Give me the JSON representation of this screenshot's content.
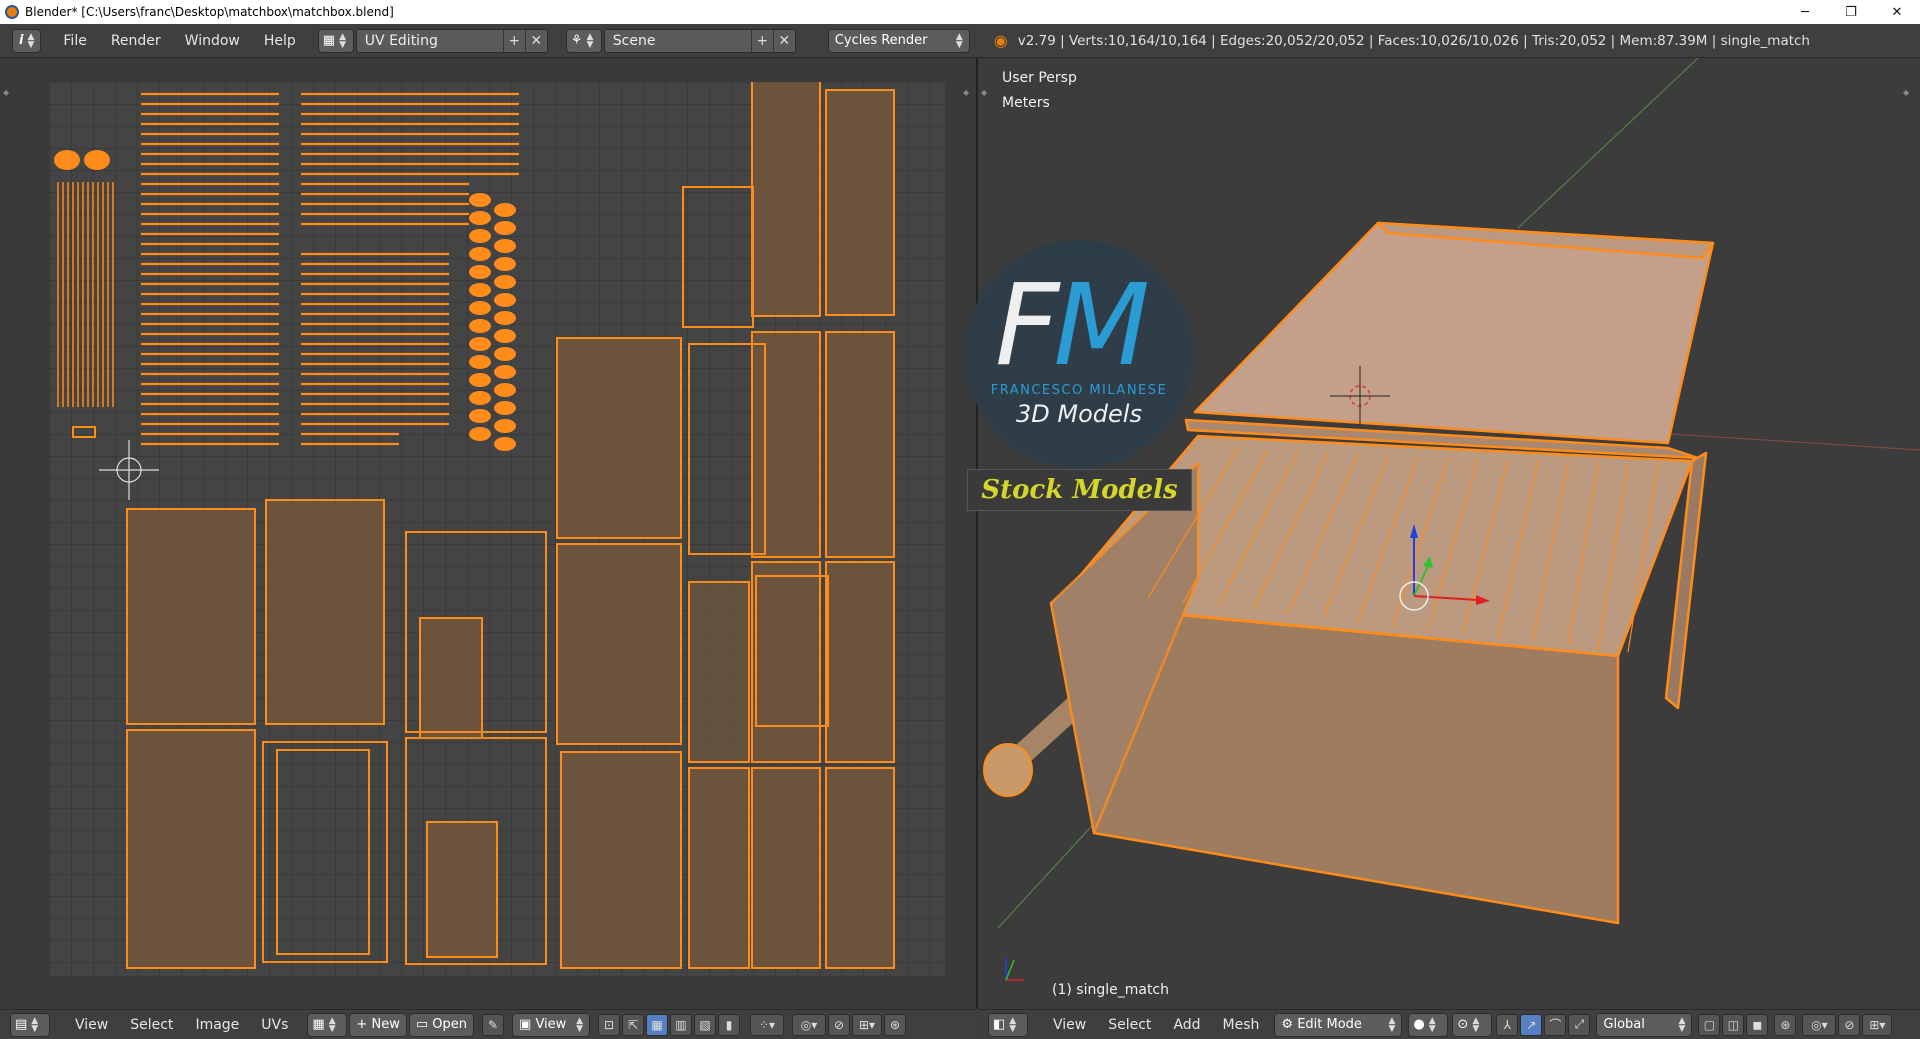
{
  "window": {
    "title": "Blender* [C:\\Users\\franc\\Desktop\\matchbox\\matchbox.blend]",
    "minimize": "─",
    "restore": "❐",
    "close": "✕"
  },
  "top_header": {
    "info_icon": "i",
    "menus": [
      "File",
      "Render",
      "Window",
      "Help"
    ],
    "screen_layout": "UV Editing",
    "scene": "Scene",
    "render_engine": "Cycles Render",
    "stats": "v2.79 | Verts:10,164/10,164 | Edges:20,052/20,052 | Faces:10,026/10,026 | Tris:20,052 | Mem:87.39M | single_match"
  },
  "view3d": {
    "view_name": "User Persp",
    "units": "Meters",
    "object_label": "(1) single_match"
  },
  "logo": {
    "f": "F",
    "m": "M",
    "brand": "FRANCESCO MILANESE",
    "sub": "3D Models",
    "stock": "Stock Models"
  },
  "uv_footer": {
    "menus": [
      "View",
      "Select",
      "Image",
      "UVs"
    ],
    "new_label": "New",
    "open_label": "Open",
    "view_label": "View"
  },
  "view3d_footer": {
    "menus": [
      "View",
      "Select",
      "Add",
      "Mesh"
    ],
    "mode": "Edit Mode",
    "orientation": "Global"
  },
  "colors": {
    "accent": "#ff8c1a",
    "uv_face": "#7a5a3a",
    "box_face": "#a07e62",
    "highlight": "#5680c2"
  }
}
